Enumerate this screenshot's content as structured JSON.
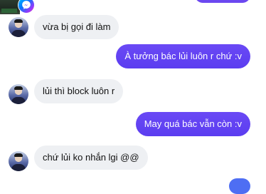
{
  "messages": [
    {
      "sender": "contact",
      "text": "vừa bị gọi đi làm"
    },
    {
      "sender": "me",
      "text": "À tưởng bác lủi luôn r chứ :v"
    },
    {
      "sender": "contact",
      "text": "lủi thì block luôn r"
    },
    {
      "sender": "me",
      "text": "May quá bác vẫn còn :v"
    },
    {
      "sender": "contact",
      "text": "chứ lủi ko nhắn lgi @@"
    }
  ],
  "colors": {
    "outgoing_bubble": "#5b3df0",
    "incoming_bubble": "#eef0f3",
    "messenger_badge": "#0078ff"
  },
  "icons": {
    "badge": "messenger-icon",
    "avatar": "contact-avatar"
  }
}
